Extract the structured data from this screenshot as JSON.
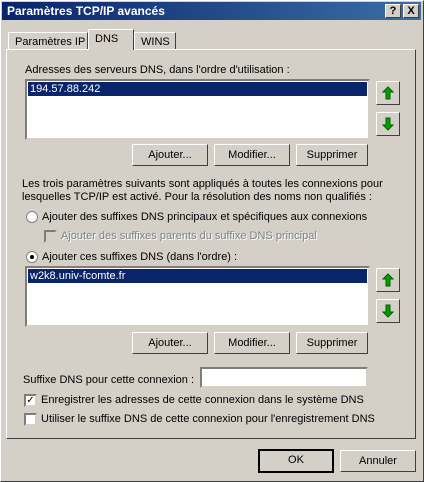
{
  "window": {
    "title": "Paramètres TCP/IP avancés",
    "help_glyph": "?",
    "close_glyph": "X"
  },
  "tabs": [
    {
      "label": "Paramètres IP"
    },
    {
      "label": "DNS"
    },
    {
      "label": "WINS"
    }
  ],
  "dns_servers": {
    "label": "Adresses des serveurs DNS, dans l'ordre d'utilisation :",
    "items": [
      "194.57.88.242"
    ],
    "add": "Ajouter...",
    "modify": "Modifier...",
    "delete": "Supprimer"
  },
  "description": {
    "line1": "Les trois paramètres suivants sont appliqués à toutes les connexions pour",
    "line2": "lesquelles TCP/IP est activé. Pour la résolution des noms non qualifiés :"
  },
  "radio_primary": {
    "label": "Ajouter des suffixes DNS principaux et spécifiques aux connexions",
    "checked": false
  },
  "check_parent": {
    "label": "Ajouter des suffixes parents du suffixe DNS principal",
    "checked": false,
    "disabled": true
  },
  "radio_suffixes": {
    "label": "Ajouter ces suffixes DNS (dans l'ordre) :",
    "checked": true
  },
  "suffixes": {
    "items": [
      "w2k8.univ-fcomte.fr"
    ],
    "add": "Ajouter...",
    "modify": "Modifier...",
    "delete": "Supprimer"
  },
  "connection_suffix": {
    "label": "Suffixe DNS pour cette connexion :",
    "value": ""
  },
  "check_register": {
    "label": "Enregistrer les adresses de cette connexion dans le système DNS",
    "checked": true
  },
  "check_use_suffix": {
    "label": "Utiliser le suffixe DNS de cette connexion pour l'enregistrement DNS",
    "checked": false
  },
  "footer": {
    "ok": "OK",
    "cancel": "Annuler"
  },
  "colors": {
    "title_bar_start": "#0a246a",
    "title_bar_end": "#3a6ea5",
    "selection": "#0a246a",
    "arrow_green": "#008000",
    "face": "#d4d0c8"
  },
  "icons": {
    "up": "up-arrow-icon",
    "down": "down-arrow-icon"
  }
}
